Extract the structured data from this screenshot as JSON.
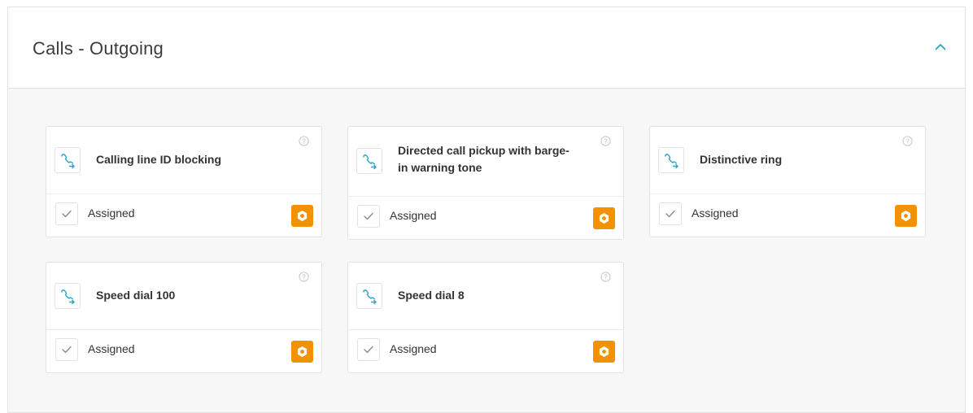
{
  "panel": {
    "title": "Calls - Outgoing",
    "toggle_icon": "chevron-up-icon"
  },
  "colors": {
    "accent": "#f39200",
    "icon_teal": "#2aa3c6",
    "border": "#e3e3e3"
  },
  "cards": [
    {
      "title": "Calling line ID blocking",
      "status": "Assigned",
      "icon": "call-forward-icon"
    },
    {
      "title": "Directed call pickup with barge-in warning tone",
      "status": "Assigned",
      "icon": "call-forward-icon"
    },
    {
      "title": "Distinctive ring",
      "status": "Assigned",
      "icon": "call-forward-icon"
    },
    {
      "title": "Speed dial 100",
      "status": "Assigned",
      "icon": "call-forward-icon"
    },
    {
      "title": "Speed dial 8",
      "status": "Assigned",
      "icon": "call-forward-icon"
    }
  ]
}
